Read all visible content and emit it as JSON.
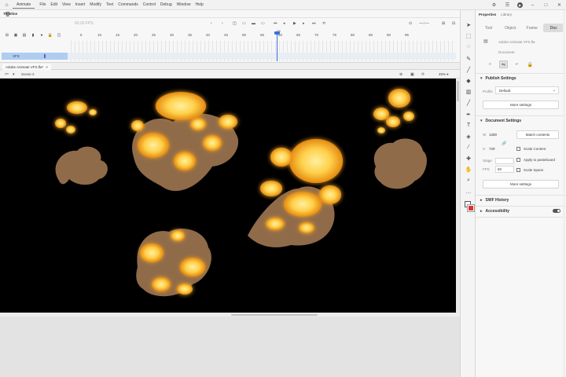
{
  "menubar": {
    "app_name": "Animate",
    "items": [
      "File",
      "Edit",
      "View",
      "Insert",
      "Modify",
      "Text",
      "Commands",
      "Control",
      "Debug",
      "Window",
      "Help"
    ]
  },
  "timeline": {
    "panel_title": "Timeline",
    "fps": "60.00",
    "fps_unit": "FPS",
    "ruler": [
      "5",
      "10",
      "15",
      "20",
      "25",
      "30",
      "35",
      "40",
      "45",
      "50",
      "55",
      "60",
      "65",
      "70",
      "75",
      "80",
      "85",
      "90",
      "95"
    ],
    "ruler_top": "1s",
    "layer_name": "VFX"
  },
  "document": {
    "tab_label": "Adobe Animate VFX.fla*",
    "tab_close": "×",
    "scene_label": "Scene 2",
    "zoom": "45%"
  },
  "properties": {
    "panel_title": "Properties",
    "library_tab": "Library",
    "subtabs": [
      "Tool",
      "Object",
      "Frame",
      "Doc"
    ],
    "file_name": "Adobe Animate VFX.fla",
    "doc_type": "Document",
    "publish_settings": {
      "heading": "Publish Settings",
      "profile_label": "Profile",
      "profile_value": "Default",
      "more_button": "More settings"
    },
    "document_settings": {
      "heading": "Document Settings",
      "w_label": "W",
      "w_value": "1280",
      "h_label": "H",
      "h_value": "720",
      "match_contents": "Match contents",
      "scale_content": "Scale Content",
      "apply_pasteboard": "Apply to pasteboard",
      "stage_label": "Stage",
      "fps_label": "FPS",
      "fps_value": "60",
      "scale_spans": "Scale Spans",
      "more_button": "More settings"
    },
    "swf_history": "SWF History",
    "accessibility": "Accessibility"
  },
  "colors": {
    "accent": "#3a6fd8",
    "layer_highlight": "#aecdf0",
    "fill_swatch": "#dd3333",
    "stage_bg": "#000000"
  }
}
